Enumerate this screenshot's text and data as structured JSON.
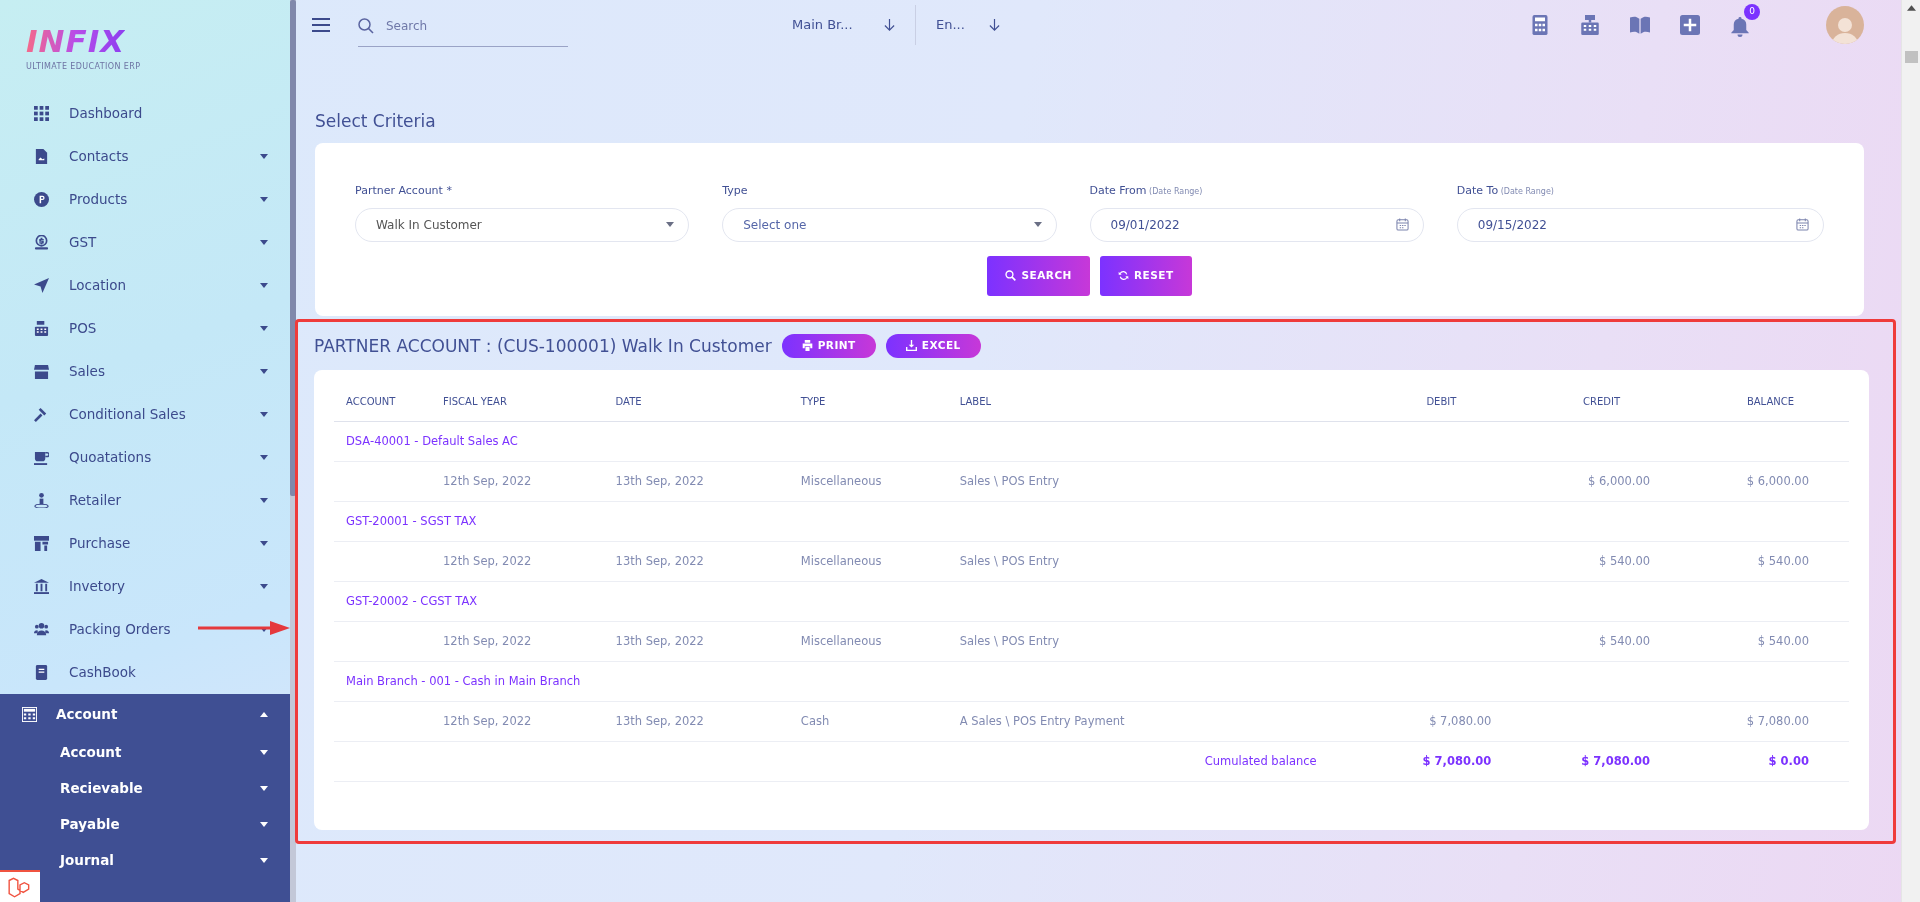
{
  "sidebar": {
    "logo": {
      "wordmark": "INFIX",
      "tagline": "ULTIMATE EDUCATION ERP"
    },
    "items": [
      {
        "label": "Dashboard",
        "kind": "link"
      },
      {
        "label": "Contacts",
        "kind": "menu",
        "expanded": false
      },
      {
        "label": "Products",
        "kind": "menu",
        "expanded": false
      },
      {
        "label": "GST",
        "kind": "menu",
        "expanded": false
      },
      {
        "label": "Location",
        "kind": "menu",
        "expanded": false
      },
      {
        "label": "POS",
        "kind": "menu",
        "expanded": false
      },
      {
        "label": "Sales",
        "kind": "menu",
        "expanded": false
      },
      {
        "label": "Conditional Sales",
        "kind": "menu",
        "expanded": false
      },
      {
        "label": "Quoatations",
        "kind": "menu",
        "expanded": false
      },
      {
        "label": "Retailer",
        "kind": "menu",
        "expanded": false
      },
      {
        "label": "Purchase",
        "kind": "menu",
        "expanded": false
      },
      {
        "label": "Invetory",
        "kind": "menu",
        "expanded": false
      },
      {
        "label": "Packing Orders",
        "kind": "menu",
        "expanded": false
      },
      {
        "label": "CashBook",
        "kind": "link"
      },
      {
        "label": "Account",
        "kind": "menu",
        "expanded": true,
        "children": [
          {
            "label": "Account",
            "expanded": false
          },
          {
            "label": "Recievable",
            "expanded": false
          },
          {
            "label": "Payable",
            "expanded": false
          },
          {
            "label": "Journal",
            "expanded": false
          }
        ]
      }
    ]
  },
  "topbar": {
    "search": {
      "placeholder": "Search"
    },
    "branch": "Main Br...",
    "language": "En...",
    "notification_count": "0"
  },
  "criteria": {
    "title": "Select Criteria",
    "fields": [
      {
        "label": "Partner Account *",
        "kind": "select",
        "value": "Walk In Customer"
      },
      {
        "label": "Type",
        "kind": "select",
        "placeholder": "Select one"
      },
      {
        "label": "Date From",
        "hint": "(Date Range)",
        "kind": "date",
        "value": "09/01/2022"
      },
      {
        "label": "Date To",
        "hint": "(Date Range)",
        "kind": "date",
        "value": "09/15/2022"
      }
    ],
    "buttons": [
      {
        "label": "SEARCH",
        "kind": "search"
      },
      {
        "label": "RESET",
        "kind": "reset"
      }
    ]
  },
  "report": {
    "title": "PARTNER ACCOUNT : (CUS-100001) Walk In Customer",
    "actions": [
      {
        "label": "PRINT",
        "kind": "print"
      },
      {
        "label": "EXCEL",
        "kind": "download"
      }
    ],
    "table": {
      "columns": [
        "ACCOUNT",
        "FISCAL YEAR",
        "DATE",
        "TYPE",
        "LABEL",
        "DEBIT",
        "CREDIT",
        "BALANCE"
      ],
      "groups": [
        {
          "account": "DSA-40001 - Default Sales AC",
          "entries": [
            {
              "fiscal_year": "12th Sep, 2022",
              "date": "13th Sep, 2022",
              "type": "Miscellaneous",
              "label": "Sales \\ POS Entry",
              "credit": "$ 6,000.00",
              "balance": "$ 6,000.00"
            }
          ]
        },
        {
          "account": "GST-20001 - SGST TAX",
          "entries": [
            {
              "fiscal_year": "12th Sep, 2022",
              "date": "13th Sep, 2022",
              "type": "Miscellaneous",
              "label": "Sales \\ POS Entry",
              "credit": "$ 540.00",
              "balance": "$ 540.00"
            }
          ]
        },
        {
          "account": "GST-20002 - CGST TAX",
          "entries": [
            {
              "fiscal_year": "12th Sep, 2022",
              "date": "13th Sep, 2022",
              "type": "Miscellaneous",
              "label": "Sales \\ POS Entry",
              "credit": "$ 540.00",
              "balance": "$ 540.00"
            }
          ]
        },
        {
          "account": "Main Branch - 001 - Cash in Main Branch",
          "entries": [
            {
              "fiscal_year": "12th Sep, 2022",
              "date": "13th Sep, 2022",
              "type": "Cash",
              "label": "A Sales \\ POS Entry Payment",
              "debit": "$ 7,080.00",
              "balance": "$ 7,080.00"
            }
          ]
        }
      ],
      "totals": {
        "label": "Cumulated balance",
        "debit": "$ 7,080.00",
        "credit": "$ 7,080.00",
        "balance": "$ 0.00"
      }
    }
  }
}
